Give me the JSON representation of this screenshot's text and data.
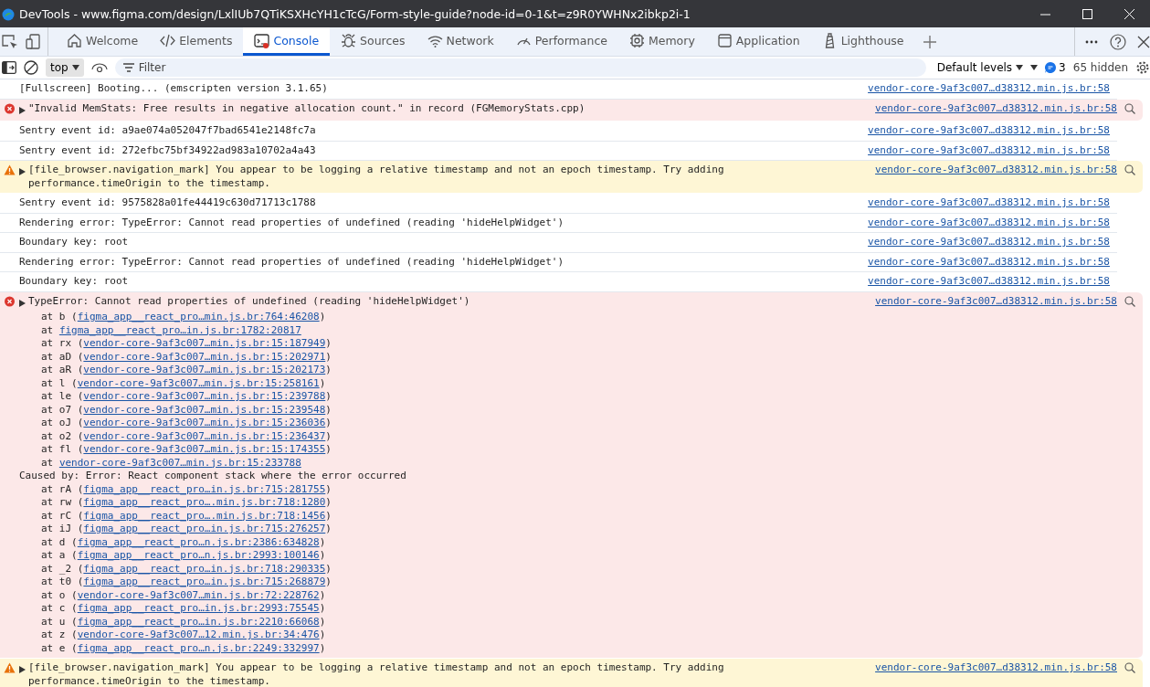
{
  "window": {
    "title": "DevTools - www.figma.com/design/LxlIUb7QTiKSXHcYH1cTcG/Form-style-guide?node-id=0-1&t=z9R0YWHNx2ibkp2i-1"
  },
  "tabs": [
    {
      "label": "Welcome",
      "selected": false
    },
    {
      "label": "Elements",
      "selected": false
    },
    {
      "label": "Console",
      "selected": true
    },
    {
      "label": "Sources",
      "selected": false
    },
    {
      "label": "Network",
      "selected": false
    },
    {
      "label": "Performance",
      "selected": false
    },
    {
      "label": "Memory",
      "selected": false
    },
    {
      "label": "Application",
      "selected": false
    },
    {
      "label": "Lighthouse",
      "selected": false
    }
  ],
  "toolbar": {
    "context": "top",
    "filter_placeholder": "Filter",
    "levels": "Default levels",
    "issues_count": "3",
    "hidden": "65 hidden"
  },
  "messages": [
    {
      "kind": "log",
      "text": "[Fullscreen] Booting... (emscripten version 3.1.65)",
      "source": "vendor-core-9af3c007…d38312.min.js.br:58"
    },
    {
      "kind": "error",
      "text": "\"Invalid MemStats: Free results in negative allocation count.\" in record (FGMemoryStats.cpp)",
      "source": "vendor-core-9af3c007…d38312.min.js.br:58"
    },
    {
      "kind": "log",
      "text": "Sentry event id: a9ae074a052047f7bad6541e2148fc7a",
      "source": "vendor-core-9af3c007…d38312.min.js.br:58"
    },
    {
      "kind": "log",
      "text": "Sentry event id: 272efbc75bf34922ad983a10702a4a43",
      "source": "vendor-core-9af3c007…d38312.min.js.br:58"
    },
    {
      "kind": "warning",
      "text": "[file_browser.navigation_mark] You appear to be logging a relative timestamp and not an epoch timestamp. Try adding performance.timeOrigin to the timestamp.",
      "source": "vendor-core-9af3c007…d38312.min.js.br:58"
    },
    {
      "kind": "log",
      "text": "Sentry event id: 9575828a01fe44419c630d71713c1788",
      "source": "vendor-core-9af3c007…d38312.min.js.br:58"
    },
    {
      "kind": "log",
      "text": "Rendering error: TypeError: Cannot read properties of undefined (reading 'hideHelpWidget')",
      "source": "vendor-core-9af3c007…d38312.min.js.br:58"
    },
    {
      "kind": "log",
      "text": "Boundary key: root",
      "source": "vendor-core-9af3c007…d38312.min.js.br:58"
    },
    {
      "kind": "log",
      "text": "Rendering error: TypeError: Cannot read properties of undefined (reading 'hideHelpWidget')",
      "source": "vendor-core-9af3c007…d38312.min.js.br:58"
    },
    {
      "kind": "log",
      "text": "Boundary key: root",
      "source": "vendor-core-9af3c007…d38312.min.js.br:58"
    },
    {
      "kind": "error",
      "text": "TypeError: Cannot read properties of undefined (reading 'hideHelpWidget')",
      "source": "vendor-core-9af3c007…d38312.min.js.br:58",
      "stack": [
        {
          "kind": "frame",
          "prefix": "at b (",
          "link": "figma_app__react_pro…min.js.br:764:46208",
          "suffix": ")"
        },
        {
          "kind": "frame",
          "prefix": "at ",
          "link": "figma_app__react_pro…in.js.br:1782:20817"
        },
        {
          "kind": "frame",
          "prefix": "at rx (",
          "link": "vendor-core-9af3c007…min.js.br:15:187949",
          "suffix": ")"
        },
        {
          "kind": "frame",
          "prefix": "at aD (",
          "link": "vendor-core-9af3c007…min.js.br:15:202971",
          "suffix": ")"
        },
        {
          "kind": "frame",
          "prefix": "at aR (",
          "link": "vendor-core-9af3c007…min.js.br:15:202173",
          "suffix": ")"
        },
        {
          "kind": "frame",
          "prefix": "at l (",
          "link": "vendor-core-9af3c007…min.js.br:15:258161",
          "suffix": ")"
        },
        {
          "kind": "frame",
          "prefix": "at le (",
          "link": "vendor-core-9af3c007…min.js.br:15:239788",
          "suffix": ")"
        },
        {
          "kind": "frame",
          "prefix": "at o7 (",
          "link": "vendor-core-9af3c007…min.js.br:15:239548",
          "suffix": ")"
        },
        {
          "kind": "frame",
          "prefix": "at oJ (",
          "link": "vendor-core-9af3c007…min.js.br:15:236036",
          "suffix": ")"
        },
        {
          "kind": "frame",
          "prefix": "at o2 (",
          "link": "vendor-core-9af3c007…min.js.br:15:236437",
          "suffix": ")"
        },
        {
          "kind": "frame",
          "prefix": "at fl (",
          "link": "vendor-core-9af3c007…min.js.br:15:174355",
          "suffix": ")"
        },
        {
          "kind": "frame",
          "prefix": "at ",
          "link": "vendor-core-9af3c007…min.js.br:15:233788"
        },
        {
          "kind": "cause",
          "text": "Caused by: Error: React component stack where the error occurred"
        },
        {
          "kind": "frame",
          "prefix": "at rA (",
          "link": "figma_app__react_pro…in.js.br:715:281755",
          "suffix": ")"
        },
        {
          "kind": "frame",
          "prefix": "at rw (",
          "link": "figma_app__react_pro….min.js.br:718:1280",
          "suffix": ")"
        },
        {
          "kind": "frame",
          "prefix": "at rC (",
          "link": "figma_app__react_pro….min.js.br:718:1456",
          "suffix": ")"
        },
        {
          "kind": "frame",
          "prefix": "at iJ (",
          "link": "figma_app__react_pro…in.js.br:715:276257",
          "suffix": ")"
        },
        {
          "kind": "frame",
          "prefix": "at d (",
          "link": "figma_app__react_pro…n.js.br:2386:634828",
          "suffix": ")"
        },
        {
          "kind": "frame",
          "prefix": "at a (",
          "link": "figma_app__react_pro…n.js.br:2993:100146",
          "suffix": ")"
        },
        {
          "kind": "frame",
          "prefix": "at _2 (",
          "link": "figma_app__react_pro…in.js.br:718:290335",
          "suffix": ")"
        },
        {
          "kind": "frame",
          "prefix": "at t0 (",
          "link": "figma_app__react_pro…in.js.br:715:268879",
          "suffix": ")"
        },
        {
          "kind": "frame",
          "prefix": "at o (",
          "link": "vendor-core-9af3c007…min.js.br:72:228762",
          "suffix": ")"
        },
        {
          "kind": "frame",
          "prefix": "at c (",
          "link": "figma_app__react_pro…in.js.br:2993:75545",
          "suffix": ")"
        },
        {
          "kind": "frame",
          "prefix": "at u (",
          "link": "figma_app__react_pro…in.js.br:2210:66068",
          "suffix": ")"
        },
        {
          "kind": "frame",
          "prefix": "at z (",
          "link": "vendor-core-9af3c007…12.min.js.br:34:476",
          "suffix": ")"
        },
        {
          "kind": "frame",
          "prefix": "at e (",
          "link": "figma_app__react_pro…n.js.br:2249:332997",
          "suffix": ")"
        }
      ]
    },
    {
      "kind": "warning",
      "text": "[file_browser.navigation_mark] You appear to be logging a relative timestamp and not an epoch timestamp. Try adding performance.timeOrigin to the timestamp.",
      "source": "vendor-core-9af3c007…d38312.min.js.br:58"
    }
  ]
}
